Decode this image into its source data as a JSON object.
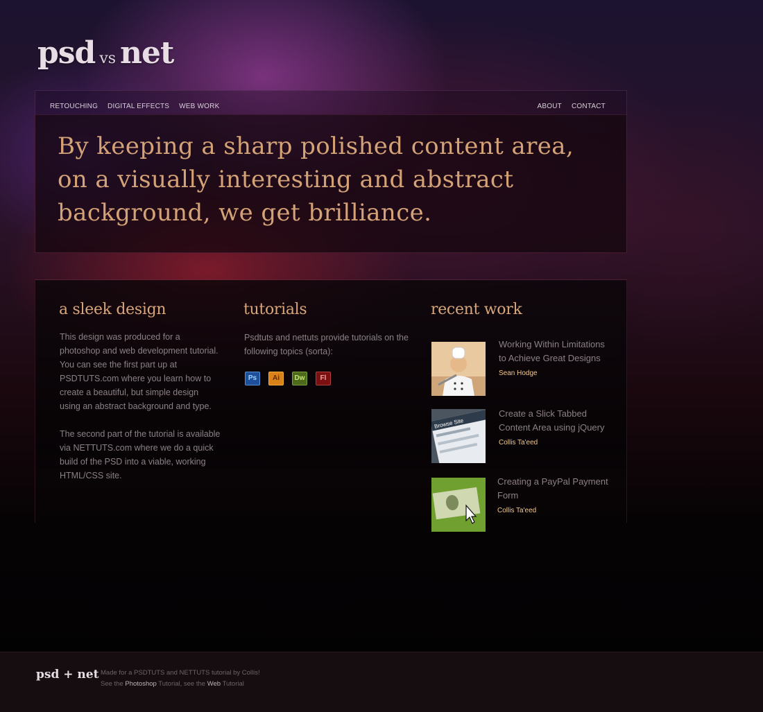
{
  "logo": {
    "left": "psd",
    "middle": "VS",
    "right": "net"
  },
  "nav": {
    "left_items": [
      "RETOUCHING",
      "DIGITAL EFFECTS",
      "WEB WORK"
    ],
    "right_items": [
      "ABOUT",
      "CONTACT"
    ]
  },
  "hero": {
    "quote": "By keeping a sharp polished content area, on a visually interesting and abstract background, we get brilliance."
  },
  "design_section": {
    "title": "a sleek design",
    "paragraph1": "This design was produced for a photoshop and web development tutorial.  You can see the first part up at PSDTUTS.com where you learn how to create a beautiful, but simple design using an abstract background and type.",
    "paragraph2": "The second part of the tutorial is available via NETTUTS.com where we do a quick build of the PSD into a viable, working HTML/CSS site."
  },
  "tutorials_section": {
    "title": "tutorials",
    "text": "Psdtuts and nettuts provide tutorials on the following topics (sorta):",
    "tools": [
      "Ps",
      "Ai",
      "Dw",
      "Fl"
    ]
  },
  "recent_work": {
    "title": "recent work",
    "items": [
      {
        "title": "Working Within Limitations to Achieve Great Designs",
        "author": "Sean Hodge"
      },
      {
        "title": "Create a Slick Tabbed Content Area using jQuery",
        "author": "Collis Ta'eed",
        "thumb_text": "Browse Site"
      },
      {
        "title": "Creating a PayPal Payment Form",
        "author": "Collis Ta'eed"
      }
    ]
  },
  "footer": {
    "logo": "psd + net",
    "line1": "Made for a PSDTUTS and NETTUTS tutorial by Collis!",
    "line2_prefix": "See the",
    "photoshop_link": "Photoshop",
    "line2_mid": "Tutorial, see the",
    "web_link": "Web",
    "line2_suffix": "Tutorial"
  }
}
